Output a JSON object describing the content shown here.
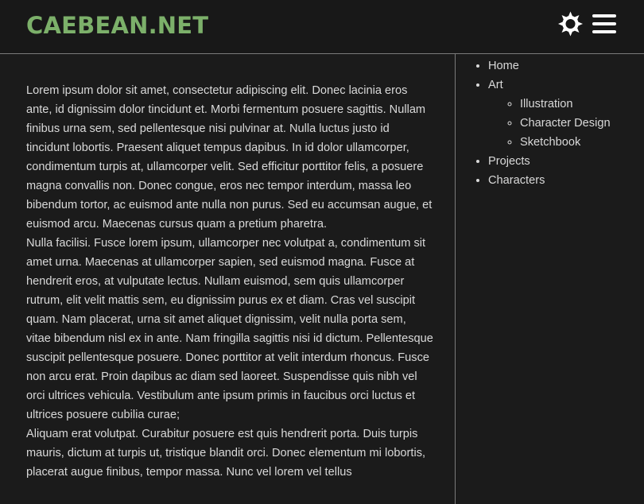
{
  "header": {
    "site_title": "CAEBEAN.NET",
    "theme_icon": "sun-gear-icon",
    "menu_icon": "hamburger-menu-icon"
  },
  "colors": {
    "background": "#1b1b1b",
    "title": "#7cb06a",
    "text": "#d9d9d9",
    "divider": "#7a7a7a"
  },
  "article": {
    "paragraphs": [
      "Lorem ipsum dolor sit amet, consectetur adipiscing elit. Donec lacinia eros ante, id dignissim dolor tincidunt et. Morbi fermentum posuere sagittis. Nullam finibus urna sem, sed pellentesque nisi pulvinar at. Nulla luctus justo id tincidunt lobortis. Praesent aliquet tempus dapibus. In id dolor ullamcorper, condimentum turpis at, ullamcorper velit. Sed efficitur porttitor felis, a posuere magna convallis non. Donec congue, eros nec tempor interdum, massa leo bibendum tortor, ac euismod ante nulla non purus. Sed eu accumsan augue, et euismod arcu. Maecenas cursus quam a pretium pharetra.",
      "Nulla facilisi. Fusce lorem ipsum, ullamcorper nec volutpat a, condimentum sit amet urna. Maecenas at ullamcorper sapien, sed euismod magna. Fusce at hendrerit eros, at vulputate lectus. Nullam euismod, sem quis ullamcorper rutrum, elit velit mattis sem, eu dignissim purus ex et diam. Cras vel suscipit quam. Nam placerat, urna sit amet aliquet dignissim, velit nulla porta sem, vitae bibendum nisl ex in ante. Nam fringilla sagittis nisi id dictum. Pellentesque suscipit pellentesque posuere. Donec porttitor at velit interdum rhoncus. Fusce non arcu erat. Proin dapibus ac diam sed laoreet. Suspendisse quis nibh vel orci ultrices vehicula. Vestibulum ante ipsum primis in faucibus orci luctus et ultrices posuere cubilia curae;",
      "Aliquam erat volutpat. Curabitur posuere est quis hendrerit porta. Duis turpis mauris, dictum at turpis ut, tristique blandit orci. Donec elementum mi lobortis, placerat augue finibus, tempor massa. Nunc vel lorem vel tellus"
    ]
  },
  "nav": {
    "items": [
      {
        "label": "Home"
      },
      {
        "label": "Art",
        "children": [
          {
            "label": "Illustration"
          },
          {
            "label": "Character Design"
          },
          {
            "label": "Sketchbook"
          }
        ]
      },
      {
        "label": "Projects"
      },
      {
        "label": "Characters"
      }
    ]
  }
}
